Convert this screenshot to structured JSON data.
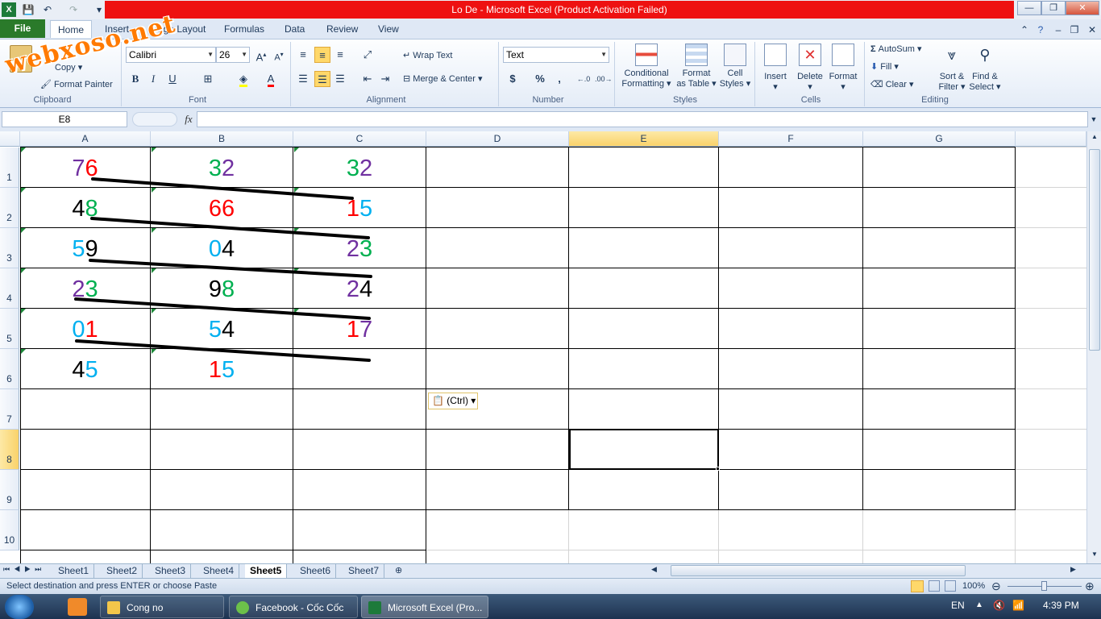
{
  "titlebar": {
    "title": "Lo De  -  Microsoft Excel (Product Activation Failed)"
  },
  "watermark": "webxoso.net",
  "tabs": {
    "file": "File",
    "home": "Home",
    "insert": "Insert",
    "page_layout": "Page Layout",
    "formulas": "Formulas",
    "data": "Data",
    "review": "Review",
    "view": "View"
  },
  "ribbon": {
    "clipboard": {
      "label": "Clipboard",
      "copy": "Copy",
      "format_painter": "Format Painter"
    },
    "font": {
      "label": "Font",
      "name": "Calibri",
      "size": "26"
    },
    "alignment": {
      "label": "Alignment",
      "wrap_text": "Wrap Text",
      "merge_center": "Merge & Center"
    },
    "number": {
      "label": "Number",
      "format": "Text",
      "currency": "$",
      "percent": "%",
      "comma": ","
    },
    "styles": {
      "label": "Styles",
      "conditional_1": "Conditional",
      "conditional_2": "Formatting",
      "format_table_1": "Format",
      "format_table_2": "as Table",
      "cell_styles_1": "Cell",
      "cell_styles_2": "Styles"
    },
    "cells": {
      "label": "Cells",
      "insert": "Insert",
      "delete": "Delete",
      "format": "Format"
    },
    "editing": {
      "label": "Editing",
      "autosum": "AutoSum",
      "fill": "Fill",
      "clear": "Clear",
      "sort_1": "Sort &",
      "sort_2": "Filter",
      "find_1": "Find &",
      "find_2": "Select"
    }
  },
  "formula_bar": {
    "name_box": "E8",
    "fx": "fx",
    "value": ""
  },
  "columns": [
    "A",
    "B",
    "C",
    "D",
    "E",
    "F",
    "G"
  ],
  "rows": [
    "1",
    "2",
    "3",
    "4",
    "5",
    "6",
    "7",
    "8",
    "9",
    "10"
  ],
  "cells": {
    "r1": [
      [
        "7",
        "6"
      ],
      [
        "3",
        "2"
      ],
      [
        "3",
        "2"
      ]
    ],
    "r2": [
      [
        "4",
        "8"
      ],
      [
        "6",
        "6"
      ],
      [
        "1",
        "5"
      ]
    ],
    "r3": [
      [
        "5",
        "9"
      ],
      [
        "0",
        "4"
      ],
      [
        "2",
        "3"
      ]
    ],
    "r4": [
      [
        "2",
        "3"
      ],
      [
        "9",
        "8"
      ],
      [
        "2",
        "4"
      ]
    ],
    "r5": [
      [
        "0",
        "1"
      ],
      [
        "5",
        "4"
      ],
      [
        "1",
        "7"
      ]
    ],
    "r6": [
      [
        "4",
        "5"
      ],
      [
        "1",
        "5"
      ]
    ]
  },
  "digit_colors": {
    "0": "#00b0f0",
    "1": "#ff0000",
    "2": "#7030a0",
    "3": "#00b050",
    "4": "#000000",
    "5": "#00b0f0",
    "6": "#ff0000",
    "7": "#7030a0",
    "8": "#00b050",
    "9": "#000000"
  },
  "paste_options": "(Ctrl)",
  "sheets": [
    "Sheet1",
    "Sheet2",
    "Sheet3",
    "Sheet4",
    "Sheet5",
    "Sheet6",
    "Sheet7"
  ],
  "active_sheet": "Sheet5",
  "status": {
    "message": "Select destination and press ENTER or choose Paste",
    "zoom": "100%"
  },
  "taskbar": {
    "items": [
      "Cong no",
      "Facebook - Cốc Cốc",
      "Microsoft Excel (Pro..."
    ],
    "lang": "EN",
    "time": "4:39 PM"
  }
}
